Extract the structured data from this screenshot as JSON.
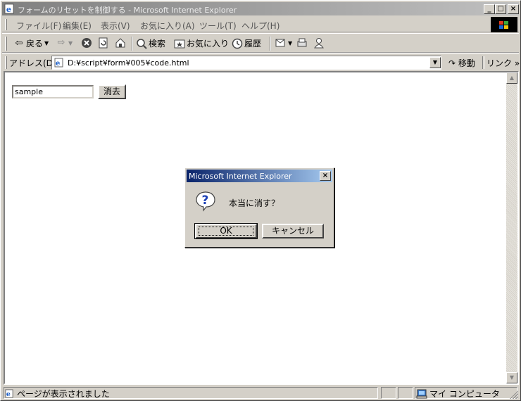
{
  "window": {
    "title": "フォームのリセットを制御する - Microsoft Internet Explorer",
    "min_label": "_",
    "max_label": "□",
    "close_label": "×"
  },
  "menu": [
    "ファイル(F)",
    "編集(E)",
    "表示(V)",
    "お気に入り(A)",
    "ツール(T)",
    "ヘルプ(H)"
  ],
  "toolbar": {
    "back_label": "戻る",
    "search_label": "検索",
    "favorites_label": "お気に入り",
    "history_label": "履歴"
  },
  "address": {
    "label": "アドレス(D)",
    "url": "D:¥script¥form¥005¥code.html",
    "go_label": "移動",
    "links_label": "リンク »"
  },
  "page": {
    "input_value": "sample",
    "clear_button": "消去"
  },
  "dialog": {
    "title": "Microsoft Internet Explorer",
    "message": "本当に消す？",
    "ok_label": "OK",
    "cancel_label": "キャンセル"
  },
  "status": {
    "text": "ページが表示されました",
    "zone": "マイ コンピュータ"
  },
  "icons": {
    "ie": "ie-page-icon",
    "question": "question-icon",
    "computer": "computer-icon"
  },
  "colors": {
    "dialog_title_start": "#0a246a",
    "dialog_title_end": "#a6caf0",
    "inactive_title_start": "#808080",
    "face": "#d4d0c8"
  }
}
